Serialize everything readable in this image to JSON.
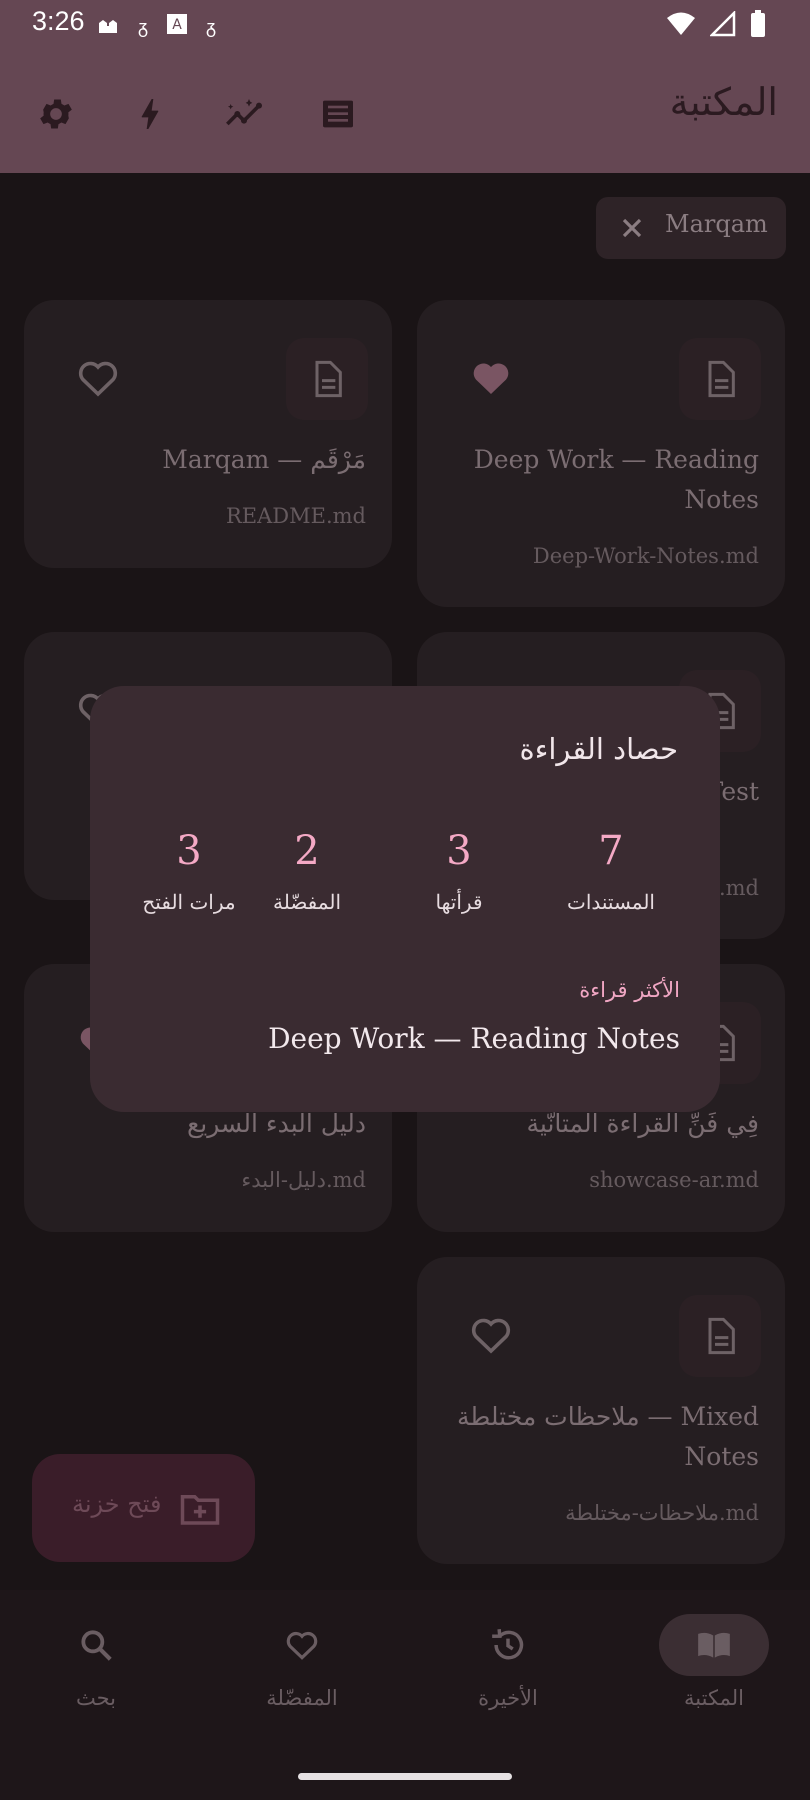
{
  "status_bar": {
    "time": "3:26",
    "left_icons": [
      "mosque-icon",
      "notification-icon",
      "a-icon",
      "notification-icon"
    ],
    "right_icons": [
      "wifi-icon",
      "signal-icon",
      "battery-icon"
    ]
  },
  "app_bar": {
    "title": "المكتبة",
    "actions": [
      "settings-icon",
      "bolt-icon",
      "insights-icon",
      "list-icon"
    ]
  },
  "filter_chip": {
    "label": "Marqam"
  },
  "cards": [
    {
      "title": "Marqam — مَرْقَم",
      "file": "README.md",
      "favorite": false
    },
    {
      "title": "Deep Work — Reading Notes",
      "file": "Deep-Work-Notes.md",
      "favorite": true
    },
    {
      "title": "",
      "file": "",
      "favorite": false
    },
    {
      "title": "مستند Test",
      "file": ".md",
      "favorite": false
    },
    {
      "title": "دليل البدء السريع",
      "file": "دليل-البدء.md",
      "favorite": true
    },
    {
      "title": "فِي فَنِّ القراءة المتأنّية",
      "file": "showcase-ar.md",
      "favorite": false
    },
    {
      "title": "ملاحظات مختلطة — Mixed Notes",
      "file": "ملاحظات-مختلطة.md",
      "favorite": false
    }
  ],
  "fab": {
    "label": "فتح خزنة"
  },
  "bottom_nav": [
    {
      "label": "المكتبة",
      "icon": "library-book-icon",
      "active": true
    },
    {
      "label": "الأخيرة",
      "icon": "history-icon",
      "active": false
    },
    {
      "label": "المفضّلة",
      "icon": "heart-icon",
      "active": false
    },
    {
      "label": "بحث",
      "icon": "search-icon",
      "active": false
    }
  ],
  "dialog": {
    "title": "حصاد القراءة",
    "stats": [
      {
        "value": "7",
        "label": "المستندات"
      },
      {
        "value": "3",
        "label": "قرأتها"
      },
      {
        "value": "2",
        "label": "المفضّلة"
      },
      {
        "value": "3",
        "label": "مرات الفتح"
      }
    ],
    "most_read_label": "الأكثر قراءة",
    "most_read_title": "Deep Work — Reading Notes"
  },
  "colors": {
    "app_bar": "#654753",
    "background": "#1a1416",
    "accent_pink": "#f4a9c5",
    "dialog": "#3a2b31"
  }
}
